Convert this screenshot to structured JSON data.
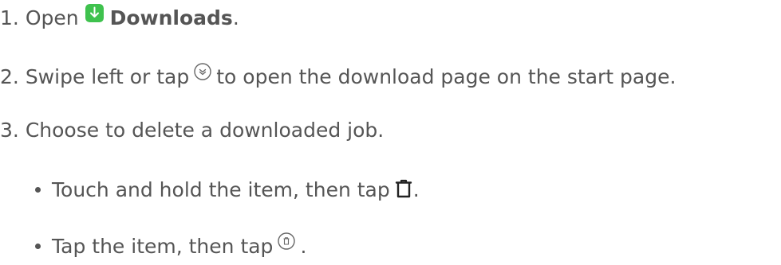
{
  "steps": [
    {
      "number": "1.",
      "before": "Open",
      "bold": "Downloads",
      "after": "."
    },
    {
      "number": "2.",
      "before": "Swipe left or tap",
      "after": "to open the download page on the start page."
    },
    {
      "number": "3.",
      "text": "Choose to delete a downloaded job."
    }
  ],
  "substeps": [
    {
      "before": "Touch and hold the item, then tap",
      "after": "."
    },
    {
      "before": "Tap the item, then tap",
      "after": "."
    }
  ],
  "icons": {
    "downloads_app": "downloads-app-icon",
    "expand_circle": "chevron-down-circle-icon",
    "trash": "trash-icon",
    "trash_circle": "trash-circle-icon"
  },
  "colors": {
    "text": "#555555",
    "downloads_green": "#3fc24e"
  }
}
